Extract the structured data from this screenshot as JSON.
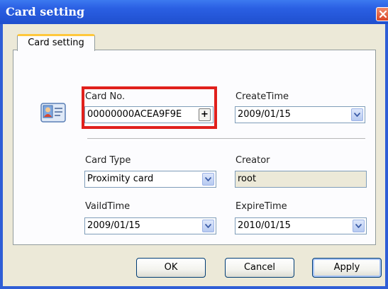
{
  "window": {
    "title": "Card setting"
  },
  "tab": {
    "label": "Card setting"
  },
  "fields": {
    "card_no": {
      "label": "Card No.",
      "value": "00000000ACEA9F9E",
      "button": "+"
    },
    "create_time": {
      "label": "CreateTime",
      "value": "2009/01/15"
    },
    "card_type": {
      "label": "Card Type",
      "value": "Proximity card"
    },
    "creator": {
      "label": "Creator",
      "value": "root"
    },
    "valid_time": {
      "label": "VaildTime",
      "value": "2009/01/15"
    },
    "expire_time": {
      "label": "ExpireTime",
      "value": "2010/01/15"
    }
  },
  "buttons": {
    "ok": "OK",
    "cancel": "Cancel",
    "apply": "Apply"
  },
  "colors": {
    "titlebar": "#2a5fe3",
    "highlight": "#e0201c",
    "tab_accent": "#ffc83c",
    "dialog_bg": "#ece9d8"
  },
  "icons": {
    "close": "close-icon",
    "card": "id-card-icon",
    "dropdown": "chevron-down-icon"
  }
}
